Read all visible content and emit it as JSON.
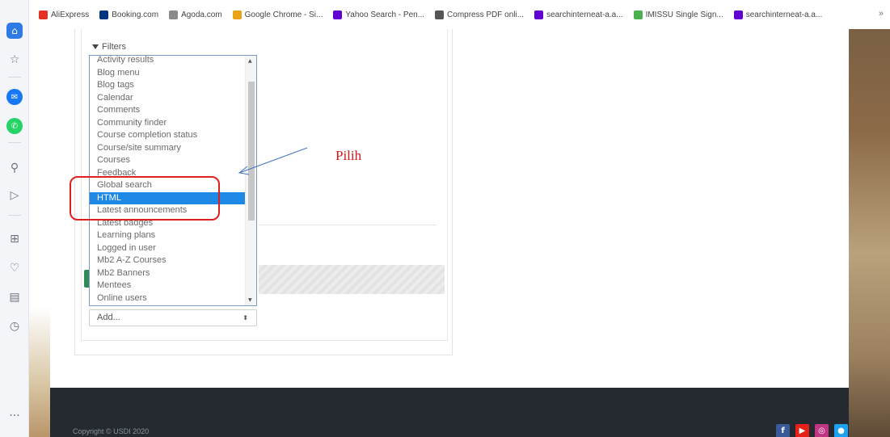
{
  "bookmarks": [
    {
      "label": "AliExpress",
      "icon": "aliexpress-icon",
      "color": "#e43225"
    },
    {
      "label": "Booking.com",
      "icon": "booking-icon",
      "color": "#003580"
    },
    {
      "label": "Agoda.com",
      "icon": "agoda-icon",
      "color": "#8a8a8a"
    },
    {
      "label": "Google Chrome - Si...",
      "icon": "chrome-icon",
      "color": "#e8a317"
    },
    {
      "label": "Yahoo Search - Pen...",
      "icon": "yahoo-icon",
      "color": "#6001d2"
    },
    {
      "label": "Compress PDF onli...",
      "icon": "pdf-icon",
      "color": "#555555"
    },
    {
      "label": "searchinterneat-a.a...",
      "icon": "yahoo-icon",
      "color": "#6001d2"
    },
    {
      "label": "IMISSU Single Sign...",
      "icon": "imissu-icon",
      "color": "#4caf50"
    },
    {
      "label": "searchinterneat-a.a...",
      "icon": "yahoo-icon",
      "color": "#6001d2"
    }
  ],
  "bookmarks_more": "»",
  "sidebar": {
    "icons": [
      "home-icon",
      "star-icon",
      "messenger-icon",
      "whatsapp-icon",
      "search-icon",
      "send-icon",
      "apps-icon",
      "heart-icon",
      "notes-icon",
      "history-icon",
      "more-icon"
    ],
    "more_label": "···"
  },
  "filters_label": "Filters",
  "block_list": {
    "options": [
      "Activity results",
      "Blog menu",
      "Blog tags",
      "Calendar",
      "Comments",
      "Community finder",
      "Course completion status",
      "Course/site summary",
      "Courses",
      "Feedback",
      "Global search",
      "HTML",
      "Latest announcements",
      "Latest badges",
      "Learning plans",
      "Logged in user",
      "Mb2 A-Z Courses",
      "Mb2 Banners",
      "Mentees",
      "Online users"
    ],
    "selected": "HTML"
  },
  "add_select": {
    "value": "Add..."
  },
  "annotation": {
    "text": "Pilih",
    "color": "#d01818"
  },
  "footer": {
    "copyright": "Copyright © USDI 2020",
    "social": [
      {
        "icon": "facebook-icon",
        "glyph": "f",
        "color": "#3b5998"
      },
      {
        "icon": "youtube-icon",
        "glyph": "▶",
        "color": "#e62117"
      },
      {
        "icon": "instagram-icon",
        "glyph": "◎",
        "color": "#c13584"
      },
      {
        "icon": "location-icon",
        "glyph": "●",
        "color": "#1da1f2"
      }
    ]
  }
}
